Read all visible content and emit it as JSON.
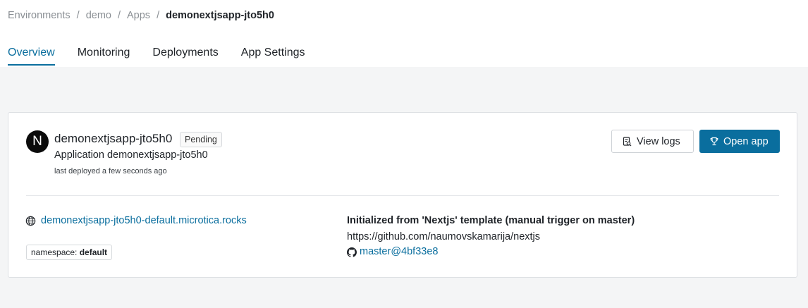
{
  "breadcrumb": {
    "items": [
      "Environments",
      "demo",
      "Apps"
    ],
    "separator": "/",
    "current": "demonextjsapp-jto5h0"
  },
  "tabs": [
    {
      "label": "Overview",
      "active": true
    },
    {
      "label": "Monitoring",
      "active": false
    },
    {
      "label": "Deployments",
      "active": false
    },
    {
      "label": "App Settings",
      "active": false
    }
  ],
  "app": {
    "logo_letter": "N",
    "name": "demonextjsapp-jto5h0",
    "status": "Pending",
    "description": "Application demonextjsapp-jto5h0",
    "last_deployed": "last deployed a few seconds ago"
  },
  "actions": {
    "view_logs": "View logs",
    "open_app": "Open app"
  },
  "details": {
    "domain": "demonextjsapp-jto5h0-default.microtica.rocks",
    "namespace_label": "namespace:",
    "namespace_value": "default",
    "init_title": "Initialized from 'Nextjs' template (manual trigger on master)",
    "repo_url": "https://github.com/naumovskamarija/nextjs",
    "commit": "master@4bf33e8"
  },
  "colors": {
    "accent": "#0a6e9e",
    "page_bg": "#f4f5f6",
    "text": "#1f2328",
    "muted": "#8a8f94"
  },
  "icons": [
    "logs-icon",
    "trophy-icon",
    "globe-icon",
    "github-icon",
    "nextjs-logo"
  ]
}
